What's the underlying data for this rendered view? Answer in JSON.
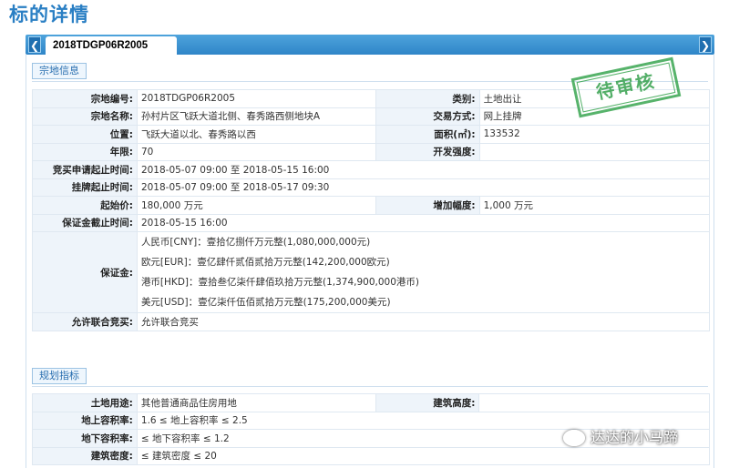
{
  "page": {
    "title": "标的详情"
  },
  "tabbar": {
    "active_tab": "2018TDGP06R2005",
    "prev_icon": "❮",
    "next_icon": "❯"
  },
  "stamp": {
    "text": "待审核",
    "color": "#3aa652"
  },
  "section1": {
    "label": "宗地信息",
    "rows": [
      {
        "l1": "宗地编号:",
        "v1": "2018TDGP06R2005",
        "l2": "类别:",
        "v2": "土地出让"
      },
      {
        "l1": "宗地名称:",
        "v1": "孙村片区飞跃大道北侧、春秀路西侧地块A",
        "l2": "交易方式:",
        "v2": "网上挂牌"
      },
      {
        "l1": "位置:",
        "v1": "飞跃大道以北、春秀路以西",
        "l2": "面积(㎡):",
        "v2": "133532"
      },
      {
        "l1": "年限:",
        "v1": "70",
        "l2": "开发强度:",
        "v2": ""
      },
      {
        "l1": "竞买申请起止时间:",
        "v1": "2018-05-07 09:00 至 2018-05-15 16:00"
      },
      {
        "l1": "挂牌起止时间:",
        "v1": "2018-05-07 09:00 至 2018-05-17 09:30"
      },
      {
        "l1": "起始价:",
        "v1": "180,000 万元",
        "l2": "增加幅度:",
        "v2": "1,000 万元"
      },
      {
        "l1": "保证金截止时间:",
        "v1": "2018-05-15 16:00"
      }
    ],
    "deposit": {
      "label": "保证金:",
      "lines": [
        "人民币[CNY]：壹拾亿捌仟万元整(1,080,000,000元)",
        "欧元[EUR]：壹亿肆仟贰佰贰拾万元整(142,200,000欧元)",
        "港币[HKD]：壹拾叁亿柒仟肆佰玖拾万元整(1,374,900,000港币)",
        "美元[USD]：壹亿柒仟伍佰贰拾万元整(175,200,000美元)"
      ]
    },
    "joint": {
      "label": "允许联合竞买:",
      "value": "允许联合竞买"
    }
  },
  "section2": {
    "label": "规划指标",
    "rows": [
      {
        "l1": "土地用途:",
        "v1": "其他普通商品住房用地",
        "l2": "建筑高度:",
        "v2": ""
      },
      {
        "l1": "地上容积率:",
        "v1": "1.6 ≤ 地上容积率 ≤ 2.5"
      },
      {
        "l1": "地下容积率:",
        "v1": "≤ 地下容积率 ≤ 1.2"
      },
      {
        "l1": "建筑密度:",
        "v1": "≤ 建筑密度 ≤ 20"
      }
    ]
  },
  "watermark": {
    "text": "达达的小马蹄"
  }
}
